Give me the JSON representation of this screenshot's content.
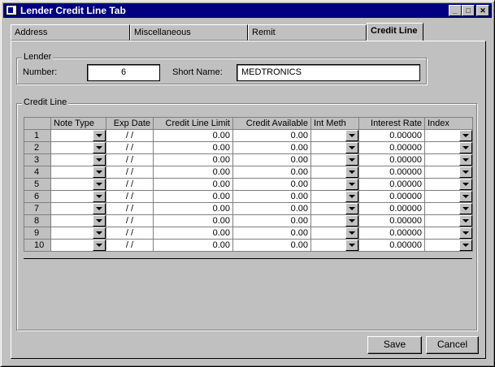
{
  "window": {
    "title": "Lender Credit Line Tab"
  },
  "title_buttons": {
    "minimize": "_",
    "maximize": "□",
    "close": "✕"
  },
  "tabs": [
    {
      "label": "Address"
    },
    {
      "label": "Miscellaneous"
    },
    {
      "label": "Remit"
    },
    {
      "label": "Credit Line"
    }
  ],
  "lender": {
    "group_label": "Lender",
    "number_label": "Number:",
    "number_value": "6",
    "short_name_label": "Short Name:",
    "short_name_value": "MEDTRONICS"
  },
  "credit_line": {
    "group_label": "Credit Line",
    "columns": [
      "",
      "Note Type",
      "Exp Date",
      "Credit Line Limit",
      "Credit Available",
      "Int Meth",
      "Interest Rate",
      "Index"
    ],
    "rows": [
      {
        "num": "1",
        "exp": "/ /",
        "limit": "0.00",
        "avail": "0.00",
        "rate": "0.00000"
      },
      {
        "num": "2",
        "exp": "/ /",
        "limit": "0.00",
        "avail": "0.00",
        "rate": "0.00000"
      },
      {
        "num": "3",
        "exp": "/ /",
        "limit": "0.00",
        "avail": "0.00",
        "rate": "0.00000"
      },
      {
        "num": "4",
        "exp": "/ /",
        "limit": "0.00",
        "avail": "0.00",
        "rate": "0.00000"
      },
      {
        "num": "5",
        "exp": "/ /",
        "limit": "0.00",
        "avail": "0.00",
        "rate": "0.00000"
      },
      {
        "num": "6",
        "exp": "/ /",
        "limit": "0.00",
        "avail": "0.00",
        "rate": "0.00000"
      },
      {
        "num": "7",
        "exp": "/ /",
        "limit": "0.00",
        "avail": "0.00",
        "rate": "0.00000"
      },
      {
        "num": "8",
        "exp": "/ /",
        "limit": "0.00",
        "avail": "0.00",
        "rate": "0.00000"
      },
      {
        "num": "9",
        "exp": "/ /",
        "limit": "0.00",
        "avail": "0.00",
        "rate": "0.00000"
      },
      {
        "num": "10",
        "exp": "/ /",
        "limit": "0.00",
        "avail": "0.00",
        "rate": "0.00000"
      }
    ]
  },
  "buttons": {
    "save": "Save",
    "cancel": "Cancel"
  }
}
